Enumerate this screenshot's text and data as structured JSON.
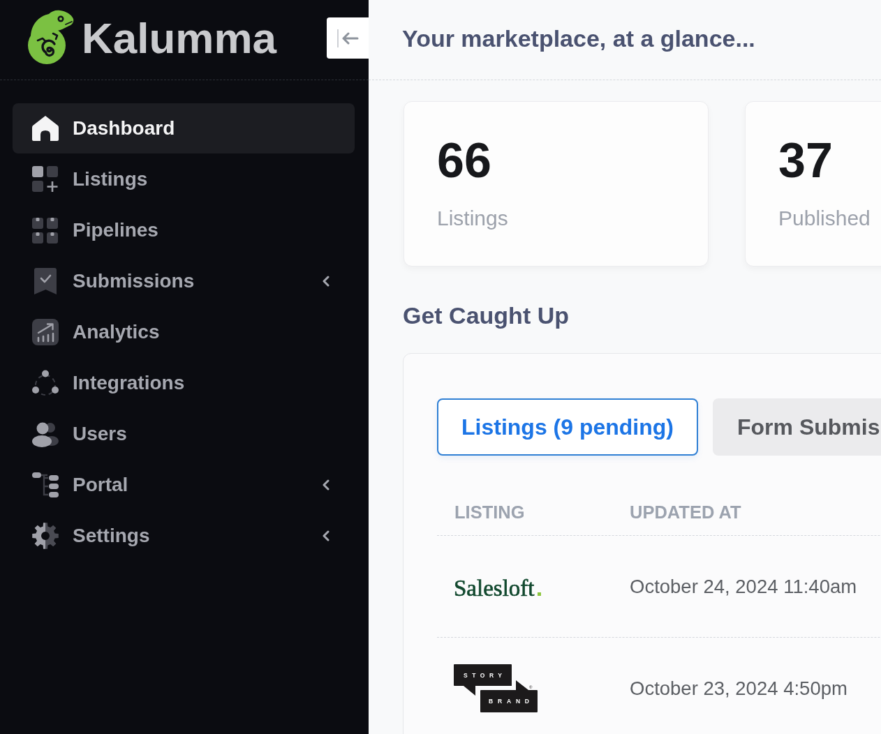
{
  "sidebar": {
    "brand": "Kalumma",
    "items": [
      {
        "label": "Dashboard",
        "selected": true,
        "has_submenu": false
      },
      {
        "label": "Listings",
        "selected": false,
        "has_submenu": false
      },
      {
        "label": "Pipelines",
        "selected": false,
        "has_submenu": false
      },
      {
        "label": "Submissions",
        "selected": false,
        "has_submenu": true
      },
      {
        "label": "Analytics",
        "selected": false,
        "has_submenu": false
      },
      {
        "label": "Integrations",
        "selected": false,
        "has_submenu": false
      },
      {
        "label": "Users",
        "selected": false,
        "has_submenu": false
      },
      {
        "label": "Portal",
        "selected": false,
        "has_submenu": true
      },
      {
        "label": "Settings",
        "selected": false,
        "has_submenu": true
      }
    ]
  },
  "header": {
    "title": "Your marketplace, at a glance..."
  },
  "stats": [
    {
      "value": "66",
      "label": "Listings"
    },
    {
      "value": "37",
      "label": "Published"
    }
  ],
  "caught_up": {
    "title": "Get Caught Up",
    "tabs": [
      {
        "label": "Listings (9 pending)",
        "selected": true
      },
      {
        "label": "Form Submis",
        "selected": false
      }
    ],
    "table": {
      "columns": [
        "LISTING",
        "UPDATED AT"
      ],
      "rows": [
        {
          "listing": {
            "kind": "wordmark",
            "text": "Salesloft"
          },
          "updated_at": "October 24, 2024 11:40am"
        },
        {
          "listing": {
            "kind": "speech_bubbles",
            "top": "STORY",
            "bottom": "BRAND",
            "mark": "®"
          },
          "updated_at": "October 23, 2024 4:50pm"
        }
      ]
    }
  }
}
